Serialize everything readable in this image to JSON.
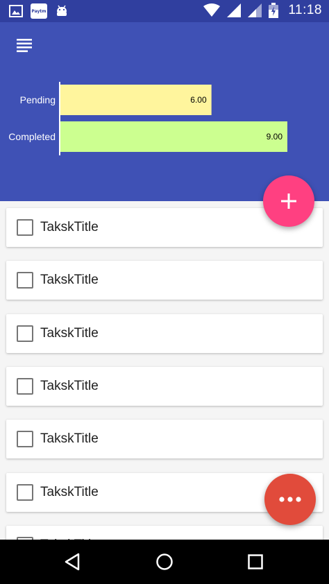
{
  "status_bar": {
    "time": "11:18",
    "paytm_label": "Paytm",
    "left_icons": [
      "image-icon",
      "paytm-icon",
      "android-icon"
    ],
    "right_icons": [
      "wifi-icon",
      "signal-icon",
      "signal-icon",
      "battery-icon"
    ]
  },
  "header": {
    "background": "#3f51b5",
    "menu_icon": "menu-icon"
  },
  "chart_data": {
    "type": "bar",
    "orientation": "horizontal",
    "categories": [
      "Pending",
      "Completed"
    ],
    "values": [
      6.0,
      9.0
    ],
    "value_labels": [
      "6.00",
      "9.00"
    ],
    "colors": [
      "#fff59d",
      "#ccff90"
    ],
    "xlim": [
      0,
      9
    ],
    "grid": false,
    "legend": "none"
  },
  "tasks": [
    {
      "title": "TakskTitle",
      "checked": false
    },
    {
      "title": "TakskTitle",
      "checked": false
    },
    {
      "title": "TakskTitle",
      "checked": false
    },
    {
      "title": "TakskTitle",
      "checked": false
    },
    {
      "title": "TakskTitle",
      "checked": false
    },
    {
      "title": "TakskTitle",
      "checked": false
    },
    {
      "title": "TakskTitle",
      "checked": false
    }
  ],
  "fab_add": {
    "icon": "plus-icon",
    "color": "#ff4081"
  },
  "fab_more": {
    "icon": "more-horizontal-icon",
    "color": "#e14b3b"
  },
  "nav_bar": {
    "icons": [
      "back-icon",
      "home-icon",
      "recents-icon"
    ]
  }
}
